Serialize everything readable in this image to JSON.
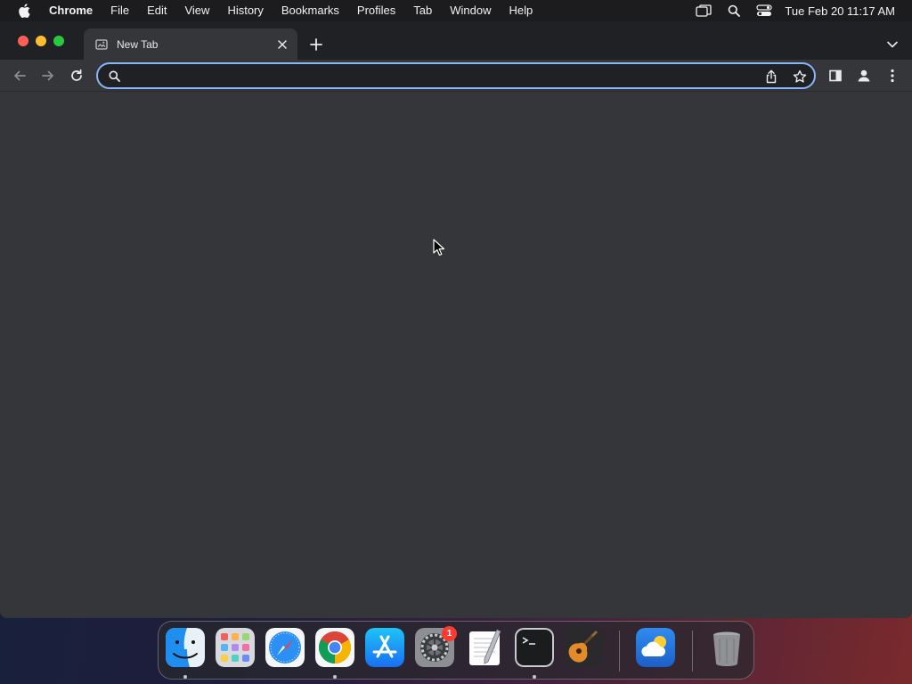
{
  "menubar": {
    "app_name": "Chrome",
    "items": [
      "File",
      "Edit",
      "View",
      "History",
      "Bookmarks",
      "Profiles",
      "Tab",
      "Window",
      "Help"
    ],
    "clock": "Tue Feb 20  11:17 AM",
    "status_icons": [
      "screen-mirroring-icon",
      "spotlight-search-icon",
      "control-center-icon"
    ]
  },
  "browser": {
    "tabs": [
      {
        "title": "New Tab",
        "active": true
      }
    ],
    "omnibox": {
      "value": "",
      "placeholder": ""
    },
    "accent_color": "#8ab4f8"
  },
  "dock": {
    "apps": [
      {
        "name": "Finder",
        "icon": "finder-icon",
        "running": true
      },
      {
        "name": "Launchpad",
        "icon": "launchpad-icon",
        "running": false
      },
      {
        "name": "Safari",
        "icon": "safari-icon",
        "running": false
      },
      {
        "name": "Google Chrome",
        "icon": "chrome-icon",
        "running": true
      },
      {
        "name": "App Store",
        "icon": "app-store-icon",
        "running": false
      },
      {
        "name": "System Settings",
        "icon": "settings-icon",
        "running": false,
        "badge": "1"
      },
      {
        "name": "TextEdit",
        "icon": "textedit-icon",
        "running": false
      },
      {
        "name": "Terminal",
        "icon": "terminal-icon",
        "running": true
      },
      {
        "name": "GarageBand",
        "icon": "garageband-icon",
        "running": false
      },
      {
        "name": "Weather",
        "icon": "weather-icon",
        "running": false
      },
      {
        "name": "Trash",
        "icon": "trash-icon",
        "running": false
      }
    ]
  }
}
